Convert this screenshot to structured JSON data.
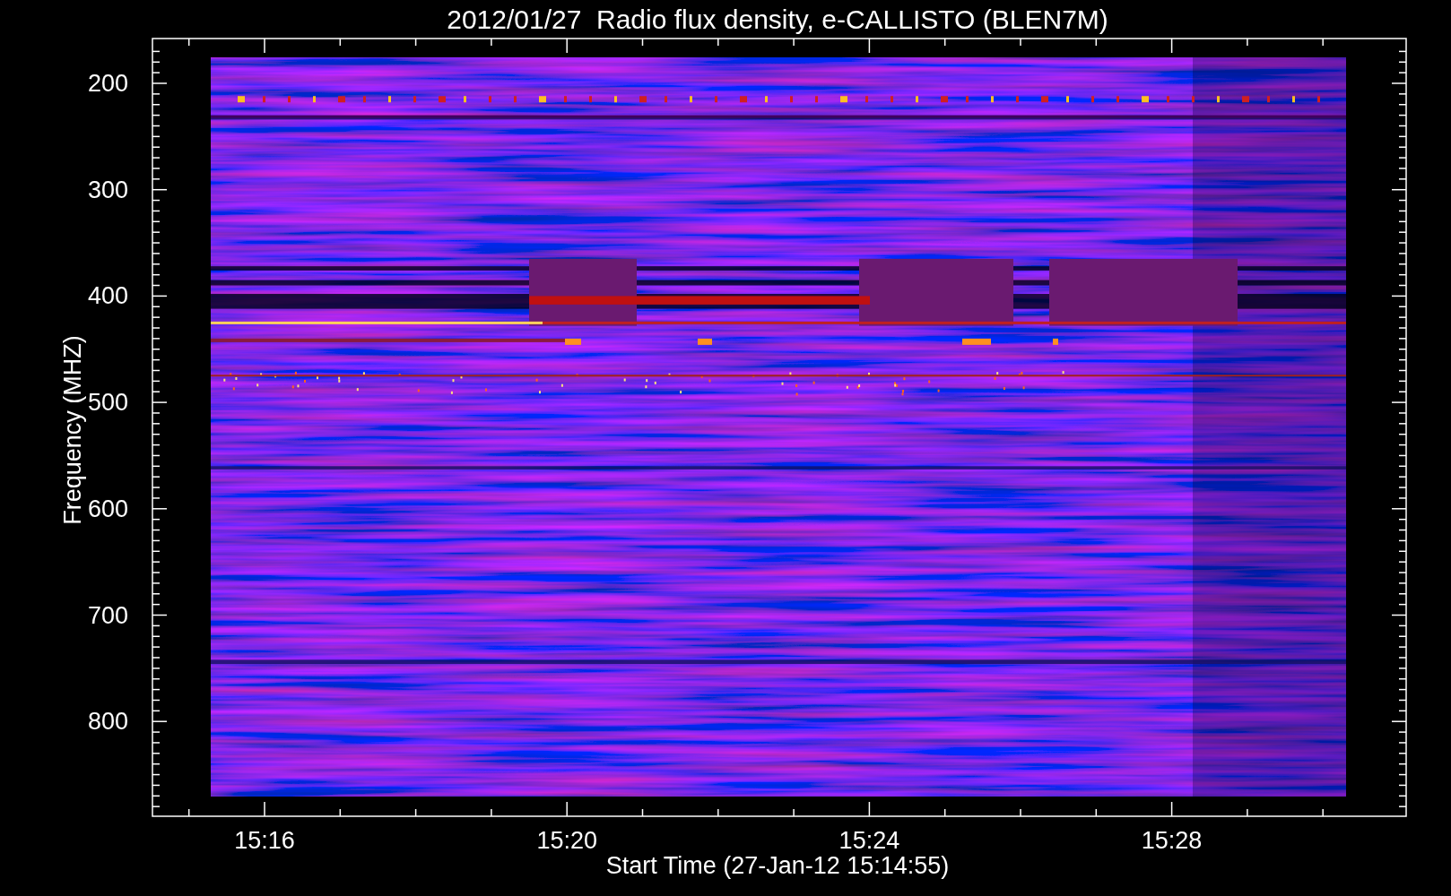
{
  "plot": {
    "title": "2012/01/27  Radio flux density, e-CALLISTO (BLEN7M)",
    "x_axis": {
      "label": "Start Time (27-Jan-12 15:14:55)",
      "ticks": [
        "15:16",
        "15:20",
        "15:24",
        "15:28"
      ]
    },
    "y_axis": {
      "label": "Frequency (MHZ)",
      "ticks": [
        "200",
        "300",
        "400",
        "500",
        "600",
        "700",
        "800"
      ]
    }
  }
}
